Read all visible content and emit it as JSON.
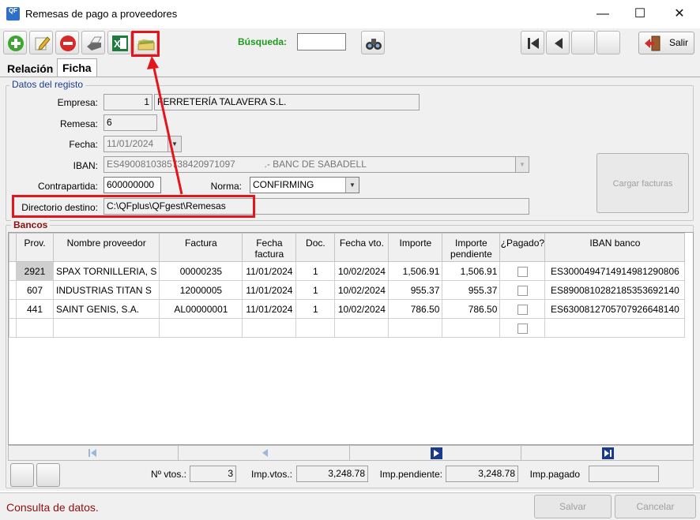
{
  "window": {
    "title": "Remesas de pago a proveedores",
    "app_icon": "QF",
    "minimize": "—",
    "maximize": "☐",
    "close": "✕"
  },
  "toolbar": {
    "search_label": "Búsqueda:",
    "search_value": "",
    "exit_label": "Salir"
  },
  "tabs": [
    {
      "label": "Relación"
    },
    {
      "label": "Ficha"
    }
  ],
  "datos": {
    "group_label": "Datos del registo",
    "empresa_label": "Empresa:",
    "empresa_code": "1",
    "empresa_name": "FERRETERÍA TALAVERA S.L.",
    "remesa_label": "Remesa:",
    "remesa_value": "6",
    "fecha_label": "Fecha:",
    "fecha_value": "11/01/2024",
    "iban_label": "IBAN:",
    "iban_value": "ES4900810385738420971097           .- BANC DE SABADELL",
    "contrapartida_label": "Contrapartida:",
    "contrapartida_value": "600000000",
    "norma_label": "Norma:",
    "norma_value": "CONFIRMING",
    "directorio_label": "Directorio destino:",
    "directorio_value": "C:\\QFplus\\QFgest\\Remesas",
    "cargar_label": "Cargar facturas"
  },
  "bancos": {
    "group_label": "Bancos",
    "columns": [
      "Prov.",
      "Nombre proveedor",
      "Factura",
      "Fecha factura",
      "Doc.",
      "Fecha vto.",
      "Importe",
      "Importe pendiente",
      "¿Pagado?",
      "IBAN banco"
    ],
    "rows": [
      {
        "prov": "2921",
        "nombre": "SPAX TORNILLERIA, S",
        "factura": "00000235",
        "fecha": "11/01/2024",
        "doc": "1",
        "vto": "10/02/2024",
        "importe": "1,506.91",
        "pendiente": "1,506.91",
        "iban": "ES3000494714914981290806"
      },
      {
        "prov": "607",
        "nombre": "INDUSTRIAS TITAN S",
        "factura": "12000005",
        "fecha": "11/01/2024",
        "doc": "1",
        "vto": "10/02/2024",
        "importe": "955.37",
        "pendiente": "955.37",
        "iban": "ES8900810282185353692140"
      },
      {
        "prov": "441",
        "nombre": "SAINT GENIS, S.A.",
        "factura": "AL00000001",
        "fecha": "11/01/2024",
        "doc": "1",
        "vto": "10/02/2024",
        "importe": "786.50",
        "pendiente": "786.50",
        "iban": "ES6300812705707926648140"
      }
    ]
  },
  "footer": {
    "nvtos_label": "Nº vtos.:",
    "nvtos_value": "3",
    "impvtos_label": "Imp.vtos.:",
    "impvtos_value": "3,248.78",
    "imppend_label": "Imp.pendiente:",
    "imppend_value": "3,248.78",
    "imppagado_label": "Imp.pagado",
    "imppagado_value": ""
  },
  "status": {
    "text": "Consulta de datos.",
    "save_label": "Salvar",
    "cancel_label": "Cancelar"
  },
  "colors": {
    "highlight": "#e3161d",
    "search_label": "#1d9a1d",
    "group_label": "#1b3c8e",
    "status_text": "#8b1010"
  }
}
